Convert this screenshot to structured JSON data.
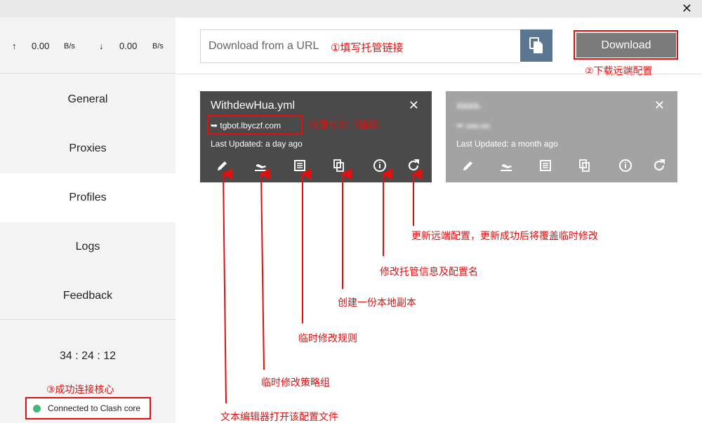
{
  "window": {
    "close_glyph": "✕"
  },
  "traffic": {
    "up_arrow": "↑",
    "up_value": "0.00",
    "up_unit": "B/s",
    "down_arrow": "↓",
    "down_value": "0.00",
    "down_unit": "B/s"
  },
  "sidebar": {
    "items": [
      {
        "label": "General"
      },
      {
        "label": "Proxies"
      },
      {
        "label": "Profiles"
      },
      {
        "label": "Logs"
      },
      {
        "label": "Feedback"
      }
    ],
    "timer": "34 : 24 : 12",
    "status": "Connected to Clash core",
    "status_color": "#3fb97a"
  },
  "download": {
    "placeholder": "Download from a URL",
    "button_label": "Download",
    "button_color": "#7a7a7a",
    "paste_icon": "copy-icon",
    "paste_color": "#5a7691"
  },
  "profiles": [
    {
      "name": "WithdewHua.yml",
      "source": "➥ tgbot.lbyczf.com",
      "updated": "Last Updated: a day ago",
      "bg": "#4a4a4a"
    },
    {
      "name": "x̶x̶x̶x̶",
      "source": "➥ x̶x̶x̶ x̶x̶",
      "updated": "Last Updated: a month ago",
      "bg": "#a3a3a3"
    }
  ],
  "card_close_glyph": "✕",
  "annotations": {
    "url": "①填写托管链接",
    "download": "②下载远端配置",
    "core": "③成功连接核心",
    "source": "托管标识（链接）",
    "update": "更新远端配置，更新成功后将覆盖临时修改",
    "info": "修改托管信息及配置名",
    "copy": "创建一份本地副本",
    "rules": "临时修改规则",
    "groups": "临时修改策略组",
    "editor": "文本编辑器打开该配置文件"
  },
  "accent": "#e01010"
}
